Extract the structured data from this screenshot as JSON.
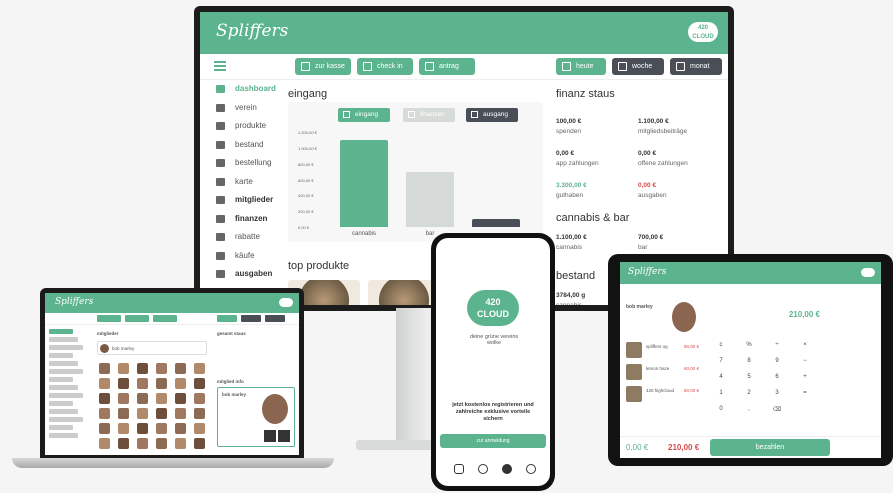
{
  "colors": {
    "accent": "#5bb48e",
    "dark": "#4a4f57",
    "red": "#d84a4a"
  },
  "monitor": {
    "logo": "Spliffers",
    "cloud_logo": "420 CLOUD",
    "toolbar": {
      "kasse": "zur kasse",
      "checkin": "check in",
      "antrag": "antrag",
      "heute": "heute",
      "woche": "woche",
      "monat": "monat"
    },
    "sidebar": [
      {
        "label": "dashboard",
        "icon": "home-icon",
        "style": "active"
      },
      {
        "label": "verein",
        "icon": "people-icon",
        "style": ""
      },
      {
        "label": "produkte",
        "icon": "leaf-icon",
        "style": ""
      },
      {
        "label": "bestand",
        "icon": "box-icon",
        "style": ""
      },
      {
        "label": "bestellung",
        "icon": "heart-icon",
        "style": ""
      },
      {
        "label": "karte",
        "icon": "card-icon",
        "style": ""
      },
      {
        "label": "mitglieder",
        "icon": "list-icon",
        "style": "bold"
      },
      {
        "label": "finanzen",
        "icon": "euro-icon",
        "style": "bold"
      },
      {
        "label": "rabatte",
        "icon": "tag-icon",
        "style": ""
      },
      {
        "label": "käufe",
        "icon": "building-icon",
        "style": ""
      },
      {
        "label": "ausgaben",
        "icon": "building-icon",
        "style": "bold"
      }
    ],
    "eingang_title": "eingang",
    "chart_tabs": {
      "eingang": "eingang",
      "finanzen": "finanzen",
      "ausgang": "ausgang"
    },
    "top_produkte_title": "top produkte",
    "finanz_title": "finanz staus",
    "finanz": [
      {
        "value": "100,00 €",
        "label": "spenden",
        "color": "#333"
      },
      {
        "value": "1.100,00 €",
        "label": "mitgliedsbeiträge",
        "color": "#333"
      },
      {
        "value": "0,00 €",
        "label": "app zahlungen",
        "color": "#333"
      },
      {
        "value": "0,00 €",
        "label": "offene zahlungen",
        "color": "#333"
      },
      {
        "value": "3.300,00 €",
        "label": "guthaben",
        "color": "#5bb48e"
      },
      {
        "value": "0,00 €",
        "label": "ausgaben",
        "color": "#d84a4a"
      }
    ],
    "cannabis_bar_title": "cannabis & bar",
    "cannabis_bar": [
      {
        "value": "1.100,00 €",
        "label": "cannabis"
      },
      {
        "value": "700,00 €",
        "label": "bar"
      }
    ],
    "bestand_title": "bestand",
    "bestand_value": "3784,00 g",
    "bestand_label": "cannabis"
  },
  "chart_data": {
    "type": "bar",
    "categories": [
      "cannabis",
      "bar"
    ],
    "values": [
      1100,
      700
    ],
    "ylim": [
      0,
      1200
    ],
    "yticks": [
      "1.200,00 €",
      "1.000,00 €",
      "800,00 €",
      "600,00 €",
      "400,00 €",
      "200,00 €",
      "0,00 €"
    ]
  },
  "laptop": {
    "logo": "Spliffers",
    "mitglieder_title": "mitglieder",
    "search_name": "bob marley",
    "finanz_title": "gesamt staus",
    "mitglied_info_title": "mitglied info",
    "member_name": "bob marley"
  },
  "phone": {
    "cloud_logo_top": "420",
    "cloud_logo_bottom": "CLOUD",
    "tagline": "deine grüne vereins wolke",
    "cta_text": "jetzt kostenlos registrieren und zahlreiche exklusive vorteile sichern",
    "cta_button": "zur anmeldung"
  },
  "tablet": {
    "logo": "Spliffers",
    "member_name": "bob marley",
    "amount": "210,00 €",
    "items": [
      {
        "name": "spliffers og",
        "price": "90,00 €"
      },
      {
        "name": "lemon haze",
        "price": "60,00 €"
      },
      {
        "name": "420 highcloud",
        "price": "60,00 €"
      }
    ],
    "keypad": [
      "c",
      "%",
      "÷",
      "×",
      "7",
      "8",
      "9",
      "−",
      "4",
      "5",
      "6",
      "+",
      "1",
      "2",
      "3",
      "=",
      "0",
      ",",
      "⌫",
      ""
    ],
    "total_left": "0,00 €",
    "total_right": "210,00 €",
    "pay_button": "bezahlen"
  }
}
